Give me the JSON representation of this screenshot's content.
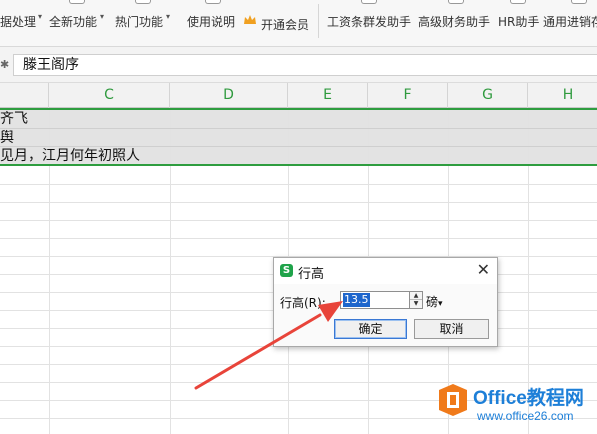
{
  "ribbon": {
    "items": [
      {
        "label": "数据处理",
        "visible": "据处理",
        "caret": true
      },
      {
        "label": "全新功能",
        "caret": true
      },
      {
        "label": "热门功能",
        "caret": true
      },
      {
        "label": "使用说明",
        "caret": false
      },
      {
        "label": "开通会员",
        "caret": false
      },
      {
        "label": "工资条群发助手",
        "caret": false
      },
      {
        "label": "高级财务助手",
        "caret": false
      },
      {
        "label": "HR助手",
        "caret": false
      },
      {
        "label": "通用进销存",
        "caret": false
      }
    ]
  },
  "formula_bar": {
    "content": "滕王阁序"
  },
  "grid": {
    "columns": [
      "C",
      "D",
      "E",
      "F",
      "G",
      "H"
    ],
    "rows": [
      {
        "text": "齐飞",
        "selected": true
      },
      {
        "text": "舆",
        "selected": true
      },
      {
        "text": "见月，江月何年初照人",
        "selected": true
      }
    ]
  },
  "dialog": {
    "title": "行高",
    "logo_text": "S",
    "close_glyph": "✕",
    "field_label": "行高(R):",
    "field_value": "13.5",
    "unit_label": "磅",
    "unit_caret": "▾",
    "ok_label": "确定",
    "cancel_label": "取消"
  },
  "watermark": {
    "title": "Office教程网",
    "url": "www.office26.com"
  },
  "colors": {
    "accent_green": "#2e9d3f",
    "arrow_red": "#e8443a",
    "selection_blue": "#1e66cc",
    "watermark_blue": "#1d7fd8",
    "watermark_orange": "#f07a1a"
  }
}
